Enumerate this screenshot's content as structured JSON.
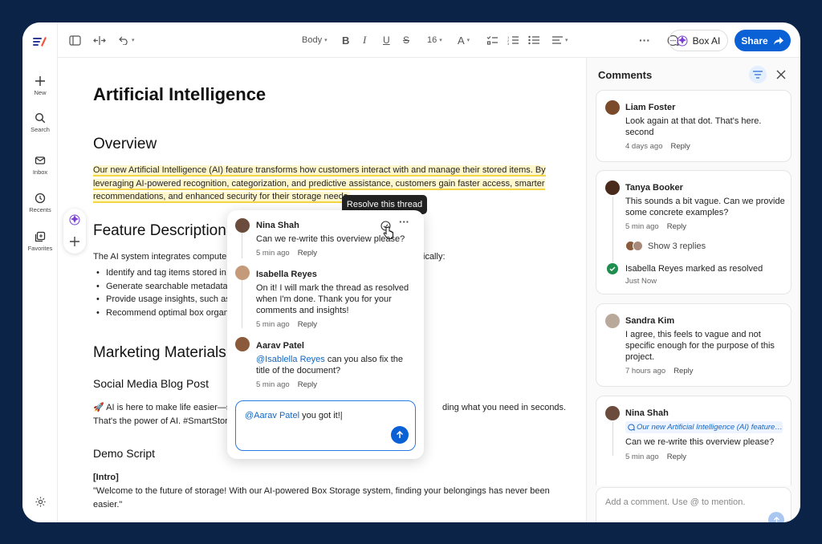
{
  "nav": {
    "new": "New",
    "search": "Search",
    "inbox": "Inbox",
    "recents": "Recents",
    "favorites": "Favorites"
  },
  "toolbar": {
    "style": "Body",
    "font_size": "16",
    "box_ai": "Box AI",
    "share": "Share"
  },
  "document": {
    "title": "Artificial Intelligence",
    "overview_heading": "Overview",
    "overview_text": "Our new Artificial Intelligence (AI) feature transforms how customers interact with and manage their stored items. By leveraging AI-powered recognition, categorization, and predictive assistance, customers gain faster access, smarter recommendations, and enhanced security for their storage needs.",
    "feature_heading": "Feature Description",
    "feature_intro": "The AI system integrates computer",
    "feature_intro_end": "ically:",
    "bullets": [
      "Identify and tag items stored in",
      "Generate searchable metadata",
      "Provide usage insights, such as t",
      "Recommend optimal box organ"
    ],
    "marketing_heading": "Marketing Materials",
    "blog_heading": "Social Media Blog Post",
    "blog_text_a": "🚀 AI is here to make life easier—sm",
    "blog_text_b": "ding what you need in seconds.",
    "blog_text_c": "That's the power of AI. #SmartStor",
    "demo_heading": "Demo Script",
    "intro_label": "[Intro]",
    "intro_quote": "\"Welcome to the future of storage! With our AI-powered Box Storage system, finding your belongings has never been easier.\""
  },
  "popup": {
    "tooltip": "Resolve this thread",
    "reply_label": "Reply",
    "comments": [
      {
        "author": "Nina Shah",
        "text": "Can we re-write this overview please?",
        "time": "5 min ago"
      },
      {
        "author": "Isabella Reyes",
        "text": "On it! I will mark the thread as resolved when I'm done. Thank you for your comments and insights!",
        "time": "5 min ago"
      },
      {
        "author": "Aarav Patel",
        "mention": "@Isablella Reyes",
        "text": " can you also fix the title of the document?",
        "time": "5 min ago"
      }
    ],
    "draft_mention": "@Aarav Patel",
    "draft_text": " you got it!|"
  },
  "panel": {
    "title": "Comments",
    "reply_label": "Reply",
    "cards": [
      {
        "author": "Liam Foster",
        "text": "Look again at that dot. That's here. second",
        "time": "4 days ago"
      },
      {
        "author": "Tanya Booker",
        "text": "This sounds a bit vague. Can we provide some concrete examples?",
        "time": "5 min ago",
        "show_replies": "Show 3 replies",
        "resolved_by": "Isabella Reyes",
        "resolved_text": " marked as resolved",
        "resolved_time": "Just Now"
      },
      {
        "author": "Sandra Kim",
        "text": "I agree, this feels to vague and not specific enough for the purpose of this project.",
        "time": "7 hours ago"
      },
      {
        "author": "Nina Shah",
        "quote": "Our new Artificial Intelligence (AI) feature t...",
        "text": "Can we re-write this overview please?",
        "time": "5 min ago"
      }
    ],
    "add_placeholder": "Add a comment. Use @ to mention."
  }
}
